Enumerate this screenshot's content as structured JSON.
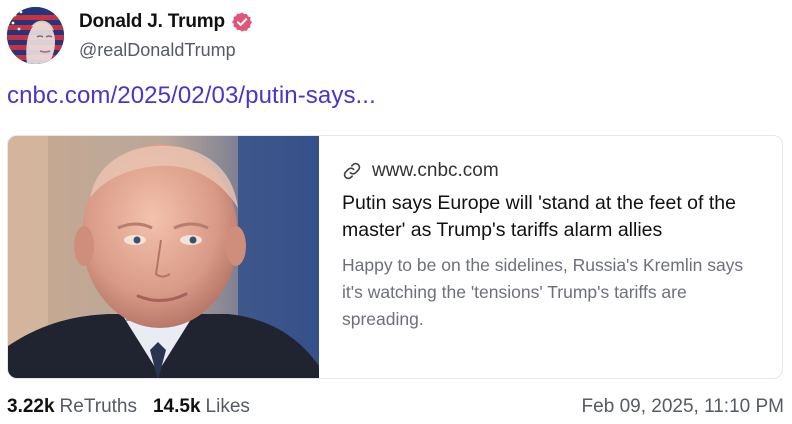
{
  "author": {
    "display_name": "Donald J. Trump",
    "handle": "@realDonaldTrump",
    "verified": true,
    "avatar_icon": "flag-portrait-avatar",
    "verified_badge_color": "#e0567a"
  },
  "post": {
    "link_text": "cnbc.com/2025/02/03/putin-says...",
    "link_color": "#4b35c9"
  },
  "card": {
    "domain": "www.cnbc.com",
    "title": "Putin says Europe will 'stand at the feet of the master' as Trump's tariffs alarm allies",
    "description": "Happy to be on the sidelines, Russia's Kremlin says it's watching the 'tensions' Trump's tariffs are spreading.",
    "link_icon": "link-chain-icon",
    "image_subject": "portrait photo"
  },
  "stats": {
    "retruths_count": "3.22k",
    "retruths_label": "ReTruths",
    "likes_count": "14.5k",
    "likes_label": "Likes",
    "timestamp": "Feb 09, 2025, 11:10 PM"
  }
}
